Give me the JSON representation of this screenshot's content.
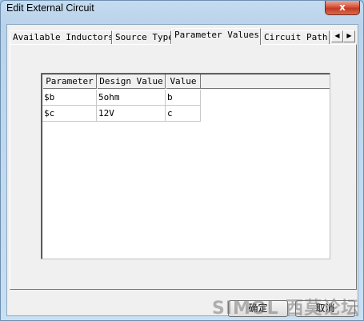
{
  "window": {
    "title": "Edit External Circuit",
    "close_glyph": "x"
  },
  "tabs": [
    {
      "label": "Available Inductors"
    },
    {
      "label": "Source Type"
    },
    {
      "label": "Parameter Values"
    },
    {
      "label": "Circuit Path"
    }
  ],
  "tab_scroll": {
    "left": "◀",
    "right": "▶"
  },
  "grid": {
    "columns": [
      "Parameter",
      "Design Value",
      "Value"
    ],
    "rows": [
      [
        "$b",
        "5ohm",
        "b"
      ],
      [
        "$c",
        "12V",
        "c"
      ]
    ]
  },
  "buttons": {
    "ok": "确定",
    "cancel": "取消"
  },
  "watermark": "SIMOL 西莫论坛"
}
